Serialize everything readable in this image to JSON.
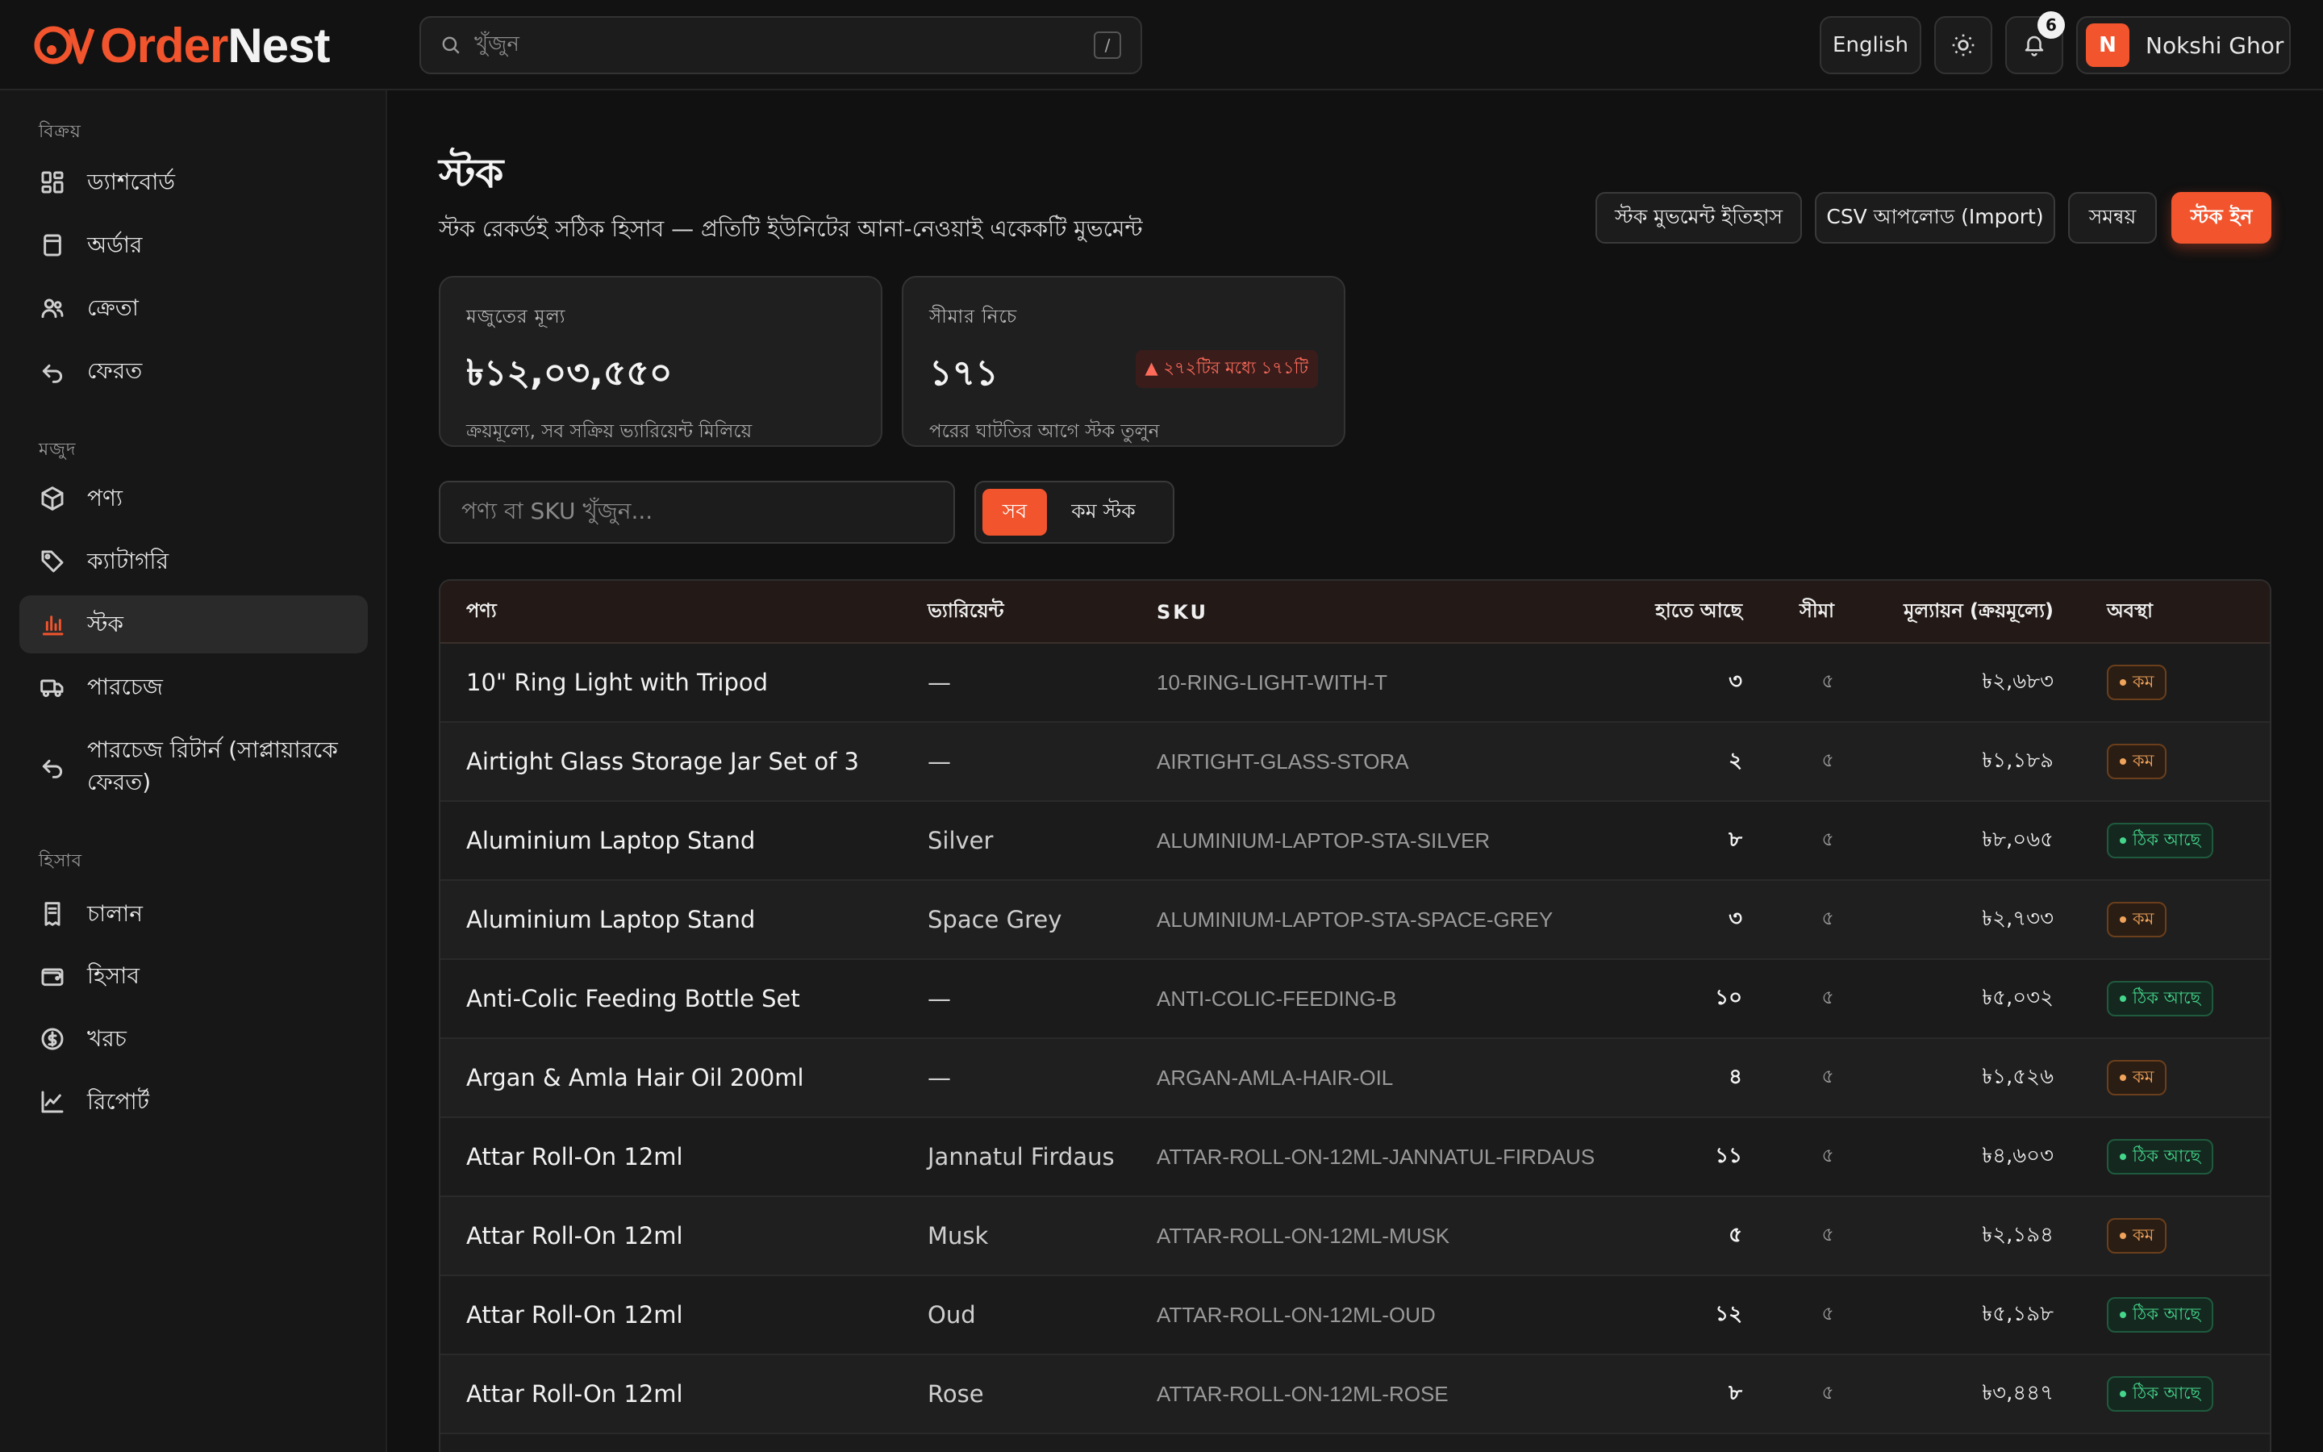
{
  "app": {
    "brand_part1": "Order",
    "brand_part2": "Nest"
  },
  "topbar": {
    "search_placeholder": "খুঁজুন",
    "search_shortcut": "/",
    "language": "English",
    "notifications_count": "6",
    "user_initial": "N",
    "user_name": "Nokshi Ghor"
  },
  "sidebar": {
    "sections": [
      {
        "title": "বিক্রয়"
      },
      {
        "title": "মজুদ"
      },
      {
        "title": "হিসাব"
      }
    ],
    "items": [
      {
        "label": "ড্যাশবোর্ড",
        "icon": "dashboard-icon"
      },
      {
        "label": "অর্ডার",
        "icon": "order-icon"
      },
      {
        "label": "ক্রেতা",
        "icon": "customers-icon"
      },
      {
        "label": "ফেরত",
        "icon": "return-icon"
      },
      {
        "label": "পণ্য",
        "icon": "box-icon"
      },
      {
        "label": "ক্যাটাগরি",
        "icon": "tag-icon"
      },
      {
        "label": "স্টক",
        "icon": "bar-chart-icon",
        "active": true
      },
      {
        "label": "পারচেজ",
        "icon": "truck-icon"
      },
      {
        "label": "পারচেজ রিটার্ন (সাপ্লায়ারকে ফেরত)",
        "icon": "return-icon"
      },
      {
        "label": "চালান",
        "icon": "receipt-icon"
      },
      {
        "label": "হিসাব",
        "icon": "wallet-icon"
      },
      {
        "label": "খরচ",
        "icon": "coin-icon"
      },
      {
        "label": "রিপোর্ট",
        "icon": "line-chart-icon"
      }
    ]
  },
  "main": {
    "title": "স্টক",
    "subtitle": "স্টক রেকর্ডই সঠিক হিসাব — প্রতিটি ইউনিটের আনা-নেওয়াই একেকটি মুভমেন্ট",
    "actions": {
      "history": "স্টক মুভমেন্ট ইতিহাস",
      "csv": "CSV আপলোড (Import)",
      "adjust": "সমন্বয়",
      "stock_in": "স্টক ইন"
    },
    "cards": {
      "value_title": "মজুতের মূল্য",
      "value_amount": "৳১২,০৩,৫৫০",
      "value_note": "ক্রয়মূল্যে, সব সক্রিয় ভ্যারিয়েন্ট মিলিয়ে",
      "low_title": "সীমার নিচে",
      "low_amount": "১৭১",
      "low_pill": "▲ ২৭২টির মধ্যে ১৭১টি",
      "low_note": "পরের ঘাটতির আগে স্টক তুলুন"
    },
    "filter_placeholder": "পণ্য বা SKU খুঁজুন...",
    "segment": {
      "all": "সব",
      "low": "কম স্টক"
    },
    "columns": {
      "product": "পণ্য",
      "variant": "ভ্যারিয়েন্ট",
      "sku": "SKU",
      "on_hand": "হাতে আছে",
      "limit": "সীমা",
      "valuation": "মূল্যায়ন (ক্রয়মূল্যে)",
      "status": "অবস্থা"
    },
    "rows": [
      {
        "product": "10\" Ring Light with Tripod",
        "variant": "—",
        "sku": "10-RING-LIGHT-WITH-T",
        "on_hand": "৩",
        "limit": "৫",
        "value": "৳২,৬৮৩",
        "status": "কম",
        "status_type": "low"
      },
      {
        "product": "Airtight Glass Storage Jar Set of 3",
        "variant": "—",
        "sku": "AIRTIGHT-GLASS-STORA",
        "on_hand": "২",
        "limit": "৫",
        "value": "৳১,১৮৯",
        "status": "কম",
        "status_type": "low"
      },
      {
        "product": "Aluminium Laptop Stand",
        "variant": "Silver",
        "sku": "ALUMINIUM-LAPTOP-STA-SILVER",
        "on_hand": "৮",
        "limit": "৫",
        "value": "৳৮,০৬৫",
        "status": "ঠিক আছে",
        "status_type": "ok"
      },
      {
        "product": "Aluminium Laptop Stand",
        "variant": "Space Grey",
        "sku": "ALUMINIUM-LAPTOP-STA-SPACE-GREY",
        "on_hand": "৩",
        "limit": "৫",
        "value": "৳২,৭৩৩",
        "status": "কম",
        "status_type": "low"
      },
      {
        "product": "Anti-Colic Feeding Bottle Set",
        "variant": "—",
        "sku": "ANTI-COLIC-FEEDING-B",
        "on_hand": "১০",
        "limit": "৫",
        "value": "৳৫,০৩২",
        "status": "ঠিক আছে",
        "status_type": "ok"
      },
      {
        "product": "Argan & Amla Hair Oil 200ml",
        "variant": "—",
        "sku": "ARGAN-AMLA-HAIR-OIL",
        "on_hand": "৪",
        "limit": "৫",
        "value": "৳১,৫২৬",
        "status": "কম",
        "status_type": "low"
      },
      {
        "product": "Attar Roll-On 12ml",
        "variant": "Jannatul Firdaus",
        "sku": "ATTAR-ROLL-ON-12ML-JANNATUL-FIRDAUS",
        "on_hand": "১১",
        "limit": "৫",
        "value": "৳৪,৬০৩",
        "status": "ঠিক আছে",
        "status_type": "ok"
      },
      {
        "product": "Attar Roll-On 12ml",
        "variant": "Musk",
        "sku": "ATTAR-ROLL-ON-12ML-MUSK",
        "on_hand": "৫",
        "limit": "৫",
        "value": "৳২,১৯৪",
        "status": "কম",
        "status_type": "low"
      },
      {
        "product": "Attar Roll-On 12ml",
        "variant": "Oud",
        "sku": "ATTAR-ROLL-ON-12ML-OUD",
        "on_hand": "১২",
        "limit": "৫",
        "value": "৳৫,১৯৮",
        "status": "ঠিক আছে",
        "status_type": "ok"
      },
      {
        "product": "Attar Roll-On 12ml",
        "variant": "Rose",
        "sku": "ATTAR-ROLL-ON-12ML-ROSE",
        "on_hand": "৮",
        "limit": "৫",
        "value": "৳৩,৪৪৭",
        "status": "ঠিক আছে",
        "status_type": "ok"
      }
    ]
  },
  "colors": {
    "accent": "#f2542d",
    "ok": "#44d68a",
    "low": "#f0a35a"
  }
}
